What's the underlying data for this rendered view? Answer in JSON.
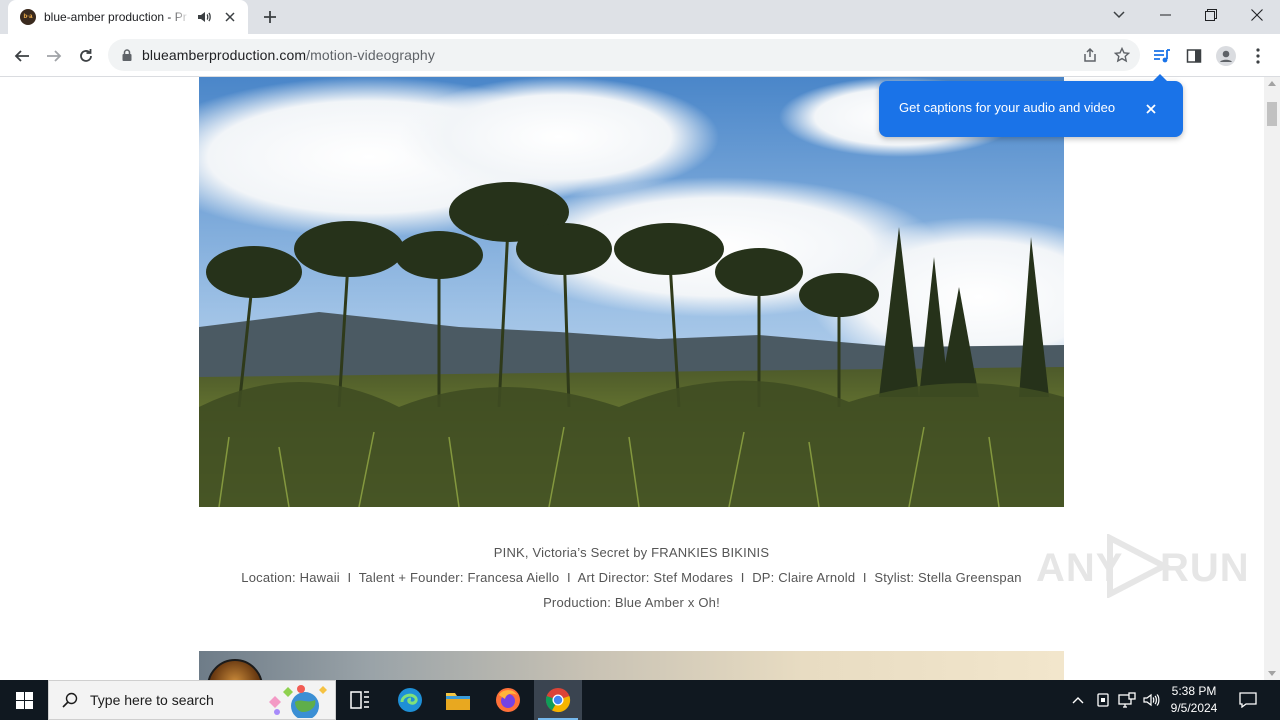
{
  "browser": {
    "tab": {
      "title": "blue-amber production - Pr",
      "favicon_text": "b·a"
    },
    "address_bar": {
      "domain": "blueamberproduction.com",
      "path": "/motion-videography"
    }
  },
  "caption_bubble": {
    "text": "Get captions for your audio and video"
  },
  "page": {
    "credits": {
      "line1": "PINK, Victoria’s Secret by FRANKIES BIKINIS",
      "line2": "Location: Hawaii  I  Talent + Founder: Francesa Aiello  I  Art Director: Stef Modares  I  DP: Claire Arnold  I  Stylist: Stella Greenspan",
      "line3": "Production: Blue Amber x Oh!"
    }
  },
  "watermark": {
    "text_left": "ANY",
    "text_right": "RUN"
  },
  "taskbar": {
    "search_placeholder": "Type here to search",
    "time": "5:38 PM",
    "date": "9/5/2024"
  },
  "colors": {
    "accent": "#1a73e8",
    "tabstrip": "#dee1e6",
    "taskbar": "#101820"
  }
}
